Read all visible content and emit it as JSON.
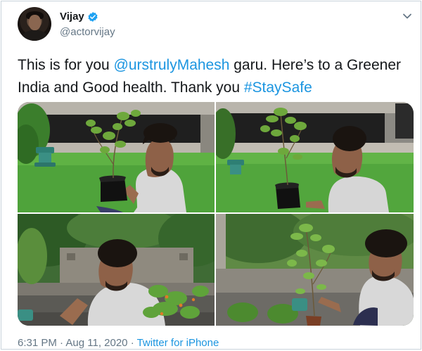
{
  "author": {
    "display_name": "Vijay",
    "handle": "@actorvijay",
    "verified": true,
    "avatar_icon": "profile-photo",
    "verified_icon": "verified-badge-icon"
  },
  "tweet": {
    "text_before_mention": "This is for you ",
    "mention": "@urstrulyMahesh",
    "text_after_mention": " garu. Here’s to a Greener India and Good health. Thank you ",
    "hashtag": "#StaySafe"
  },
  "media": {
    "photo_count": 4
  },
  "footer": {
    "time": "6:31 PM",
    "separator_1": " · ",
    "date": "Aug 11, 2020",
    "separator_2": " · ",
    "source": "Twitter for iPhone"
  },
  "colors": {
    "link": "#1b95e0",
    "text": "#14171a",
    "muted": "#657786",
    "verified": "#1da1f2",
    "border": "#c9d3db"
  },
  "icons": {
    "more": "chevron-down-icon"
  }
}
